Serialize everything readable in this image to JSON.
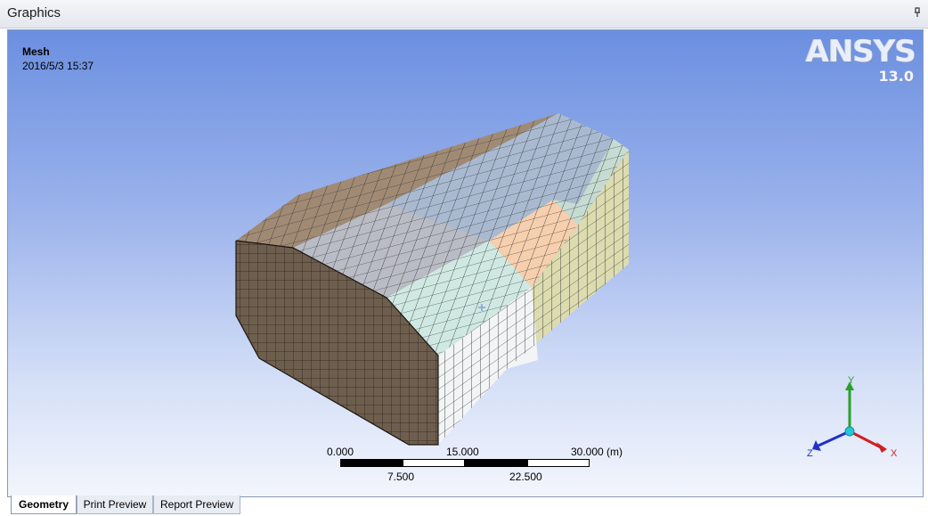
{
  "window": {
    "title": "Graphics",
    "pin_icon": "pin-icon"
  },
  "viewport": {
    "label": "Mesh",
    "timestamp": "2016/5/3 15:37",
    "logo": {
      "brand": "ANSYS",
      "version": "13.0"
    }
  },
  "scale_bar": {
    "top_labels": [
      "0.000",
      "15.000",
      "30.000 (m)"
    ],
    "bottom_labels": [
      "7.500",
      "22.500"
    ]
  },
  "triad": {
    "x_label": "X",
    "y_label": "Y",
    "z_label": "Z"
  },
  "tabs": [
    {
      "label": "Geometry",
      "active": true
    },
    {
      "label": "Print Preview",
      "active": false
    },
    {
      "label": "Report Preview",
      "active": false
    }
  ],
  "colors": {
    "mesh_front": "#6e5e4e",
    "mesh_top_gray": "#b9bcc4",
    "mesh_top_blue": "#a9bad0",
    "mesh_face_cyan": "#cfe9e2",
    "mesh_face_peach": "#f6cfae",
    "mesh_face_yellow": "#dcdcb0",
    "triad_x": "#d02020",
    "triad_y": "#2aa02a",
    "triad_z": "#2030c8"
  }
}
